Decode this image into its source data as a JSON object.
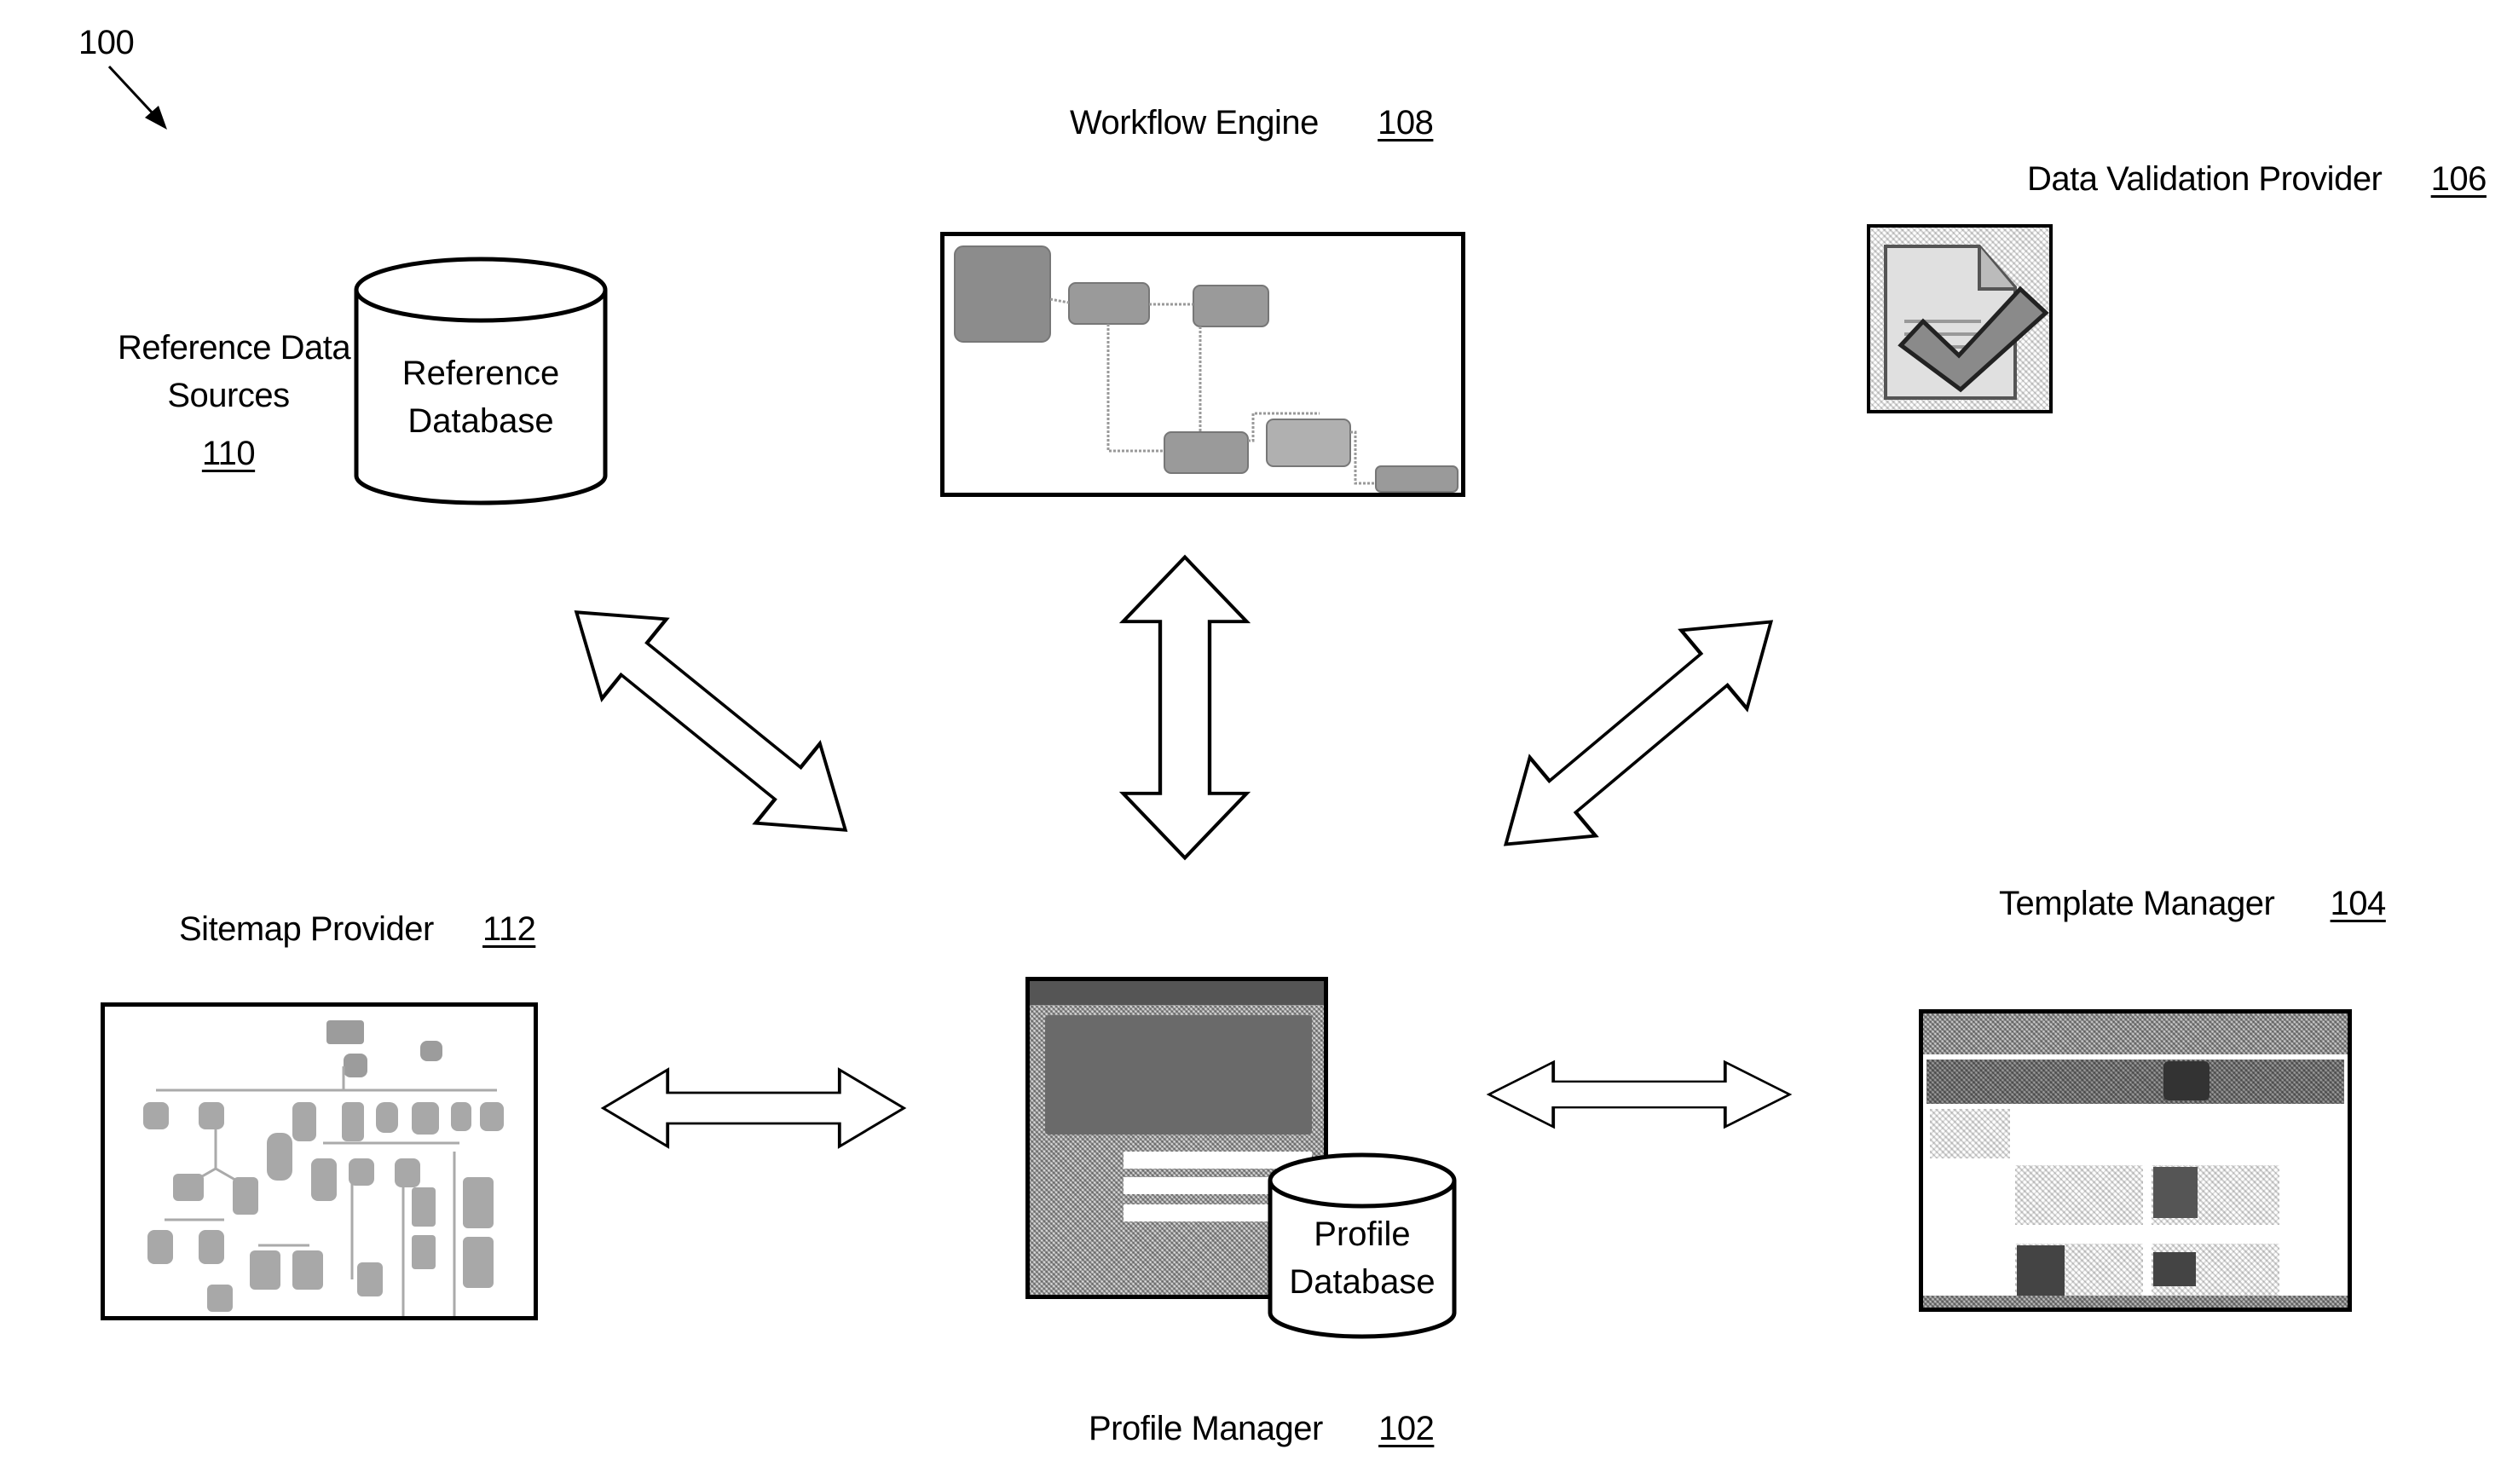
{
  "figure": {
    "ref_number": "100"
  },
  "components": {
    "workflow_engine": {
      "label": "Workflow Engine",
      "ref": "108"
    },
    "data_validation_provider": {
      "label": "Data Validation Provider",
      "ref": "106"
    },
    "reference_data_sources": {
      "label_line1": "Reference Data",
      "label_line2": "Sources",
      "ref": "110",
      "cylinder_line1": "Reference",
      "cylinder_line2": "Database"
    },
    "sitemap_provider": {
      "label": "Sitemap Provider",
      "ref": "112"
    },
    "profile_manager": {
      "label": "Profile Manager",
      "ref": "102",
      "cylinder_line1": "Profile",
      "cylinder_line2": "Database"
    },
    "template_manager": {
      "label": "Template Manager",
      "ref": "104"
    }
  },
  "connections": [
    {
      "from": "reference_data_sources",
      "to": "profile_manager",
      "type": "bidirectional"
    },
    {
      "from": "workflow_engine",
      "to": "profile_manager",
      "type": "bidirectional"
    },
    {
      "from": "data_validation_provider",
      "to": "profile_manager",
      "type": "bidirectional"
    },
    {
      "from": "sitemap_provider",
      "to": "profile_manager",
      "type": "bidirectional"
    },
    {
      "from": "template_manager",
      "to": "profile_manager",
      "type": "bidirectional"
    }
  ]
}
